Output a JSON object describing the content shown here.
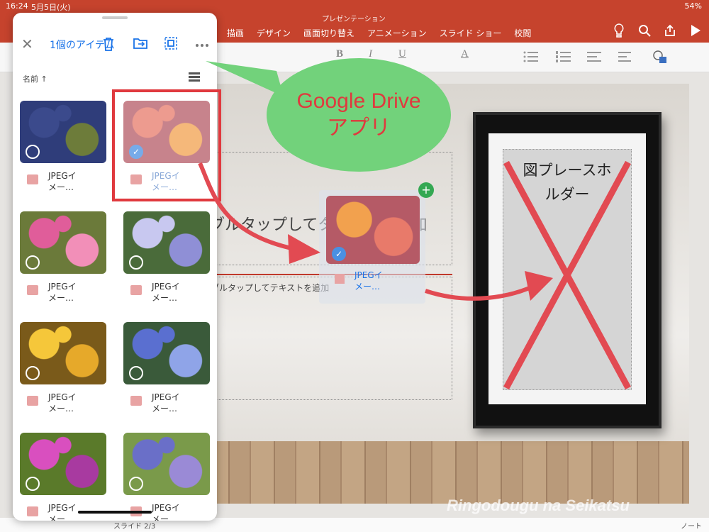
{
  "status": {
    "time": "16:24",
    "date": "5月5日(火)",
    "battery": "54%"
  },
  "ribbon": {
    "doc_title": "プレゼンテーション",
    "tabs": [
      "描画",
      "デザイン",
      "画面切り替え",
      "アニメーション",
      "スライド ショー",
      "校閲"
    ]
  },
  "toolbar": {
    "bold": "B",
    "italic": "I",
    "underline": "U",
    "color": "A"
  },
  "slide": {
    "title_placeholder": "ブルタップしてタイトルを追加",
    "text_placeholder": "ブルタップしてテキストを追加",
    "picture_placeholder_line1": "図プレースホ",
    "picture_placeholder_line2": "ルダー"
  },
  "drive_panel": {
    "header": "1個のアイテム",
    "sort_label": "名前 ↑",
    "items": [
      {
        "name": "JPEGイ\nメー…",
        "selected": false,
        "colors": [
          "#3b4a8c",
          "#6d7c3a",
          "#2f3d7a"
        ]
      },
      {
        "name": "JPEGイ\nメー…",
        "selected": true,
        "colors": [
          "#e87a6a",
          "#f2a14e",
          "#b55a66"
        ]
      },
      {
        "name": "JPEGイ\nメー…",
        "selected": false,
        "colors": [
          "#e05d9a",
          "#f28fb8",
          "#6b7a3a"
        ]
      },
      {
        "name": "JPEGイ\nメー…",
        "selected": false,
        "colors": [
          "#c8c8f0",
          "#8f8fd6",
          "#4a6b3a"
        ]
      },
      {
        "name": "JPEGイ\nメー…",
        "selected": false,
        "colors": [
          "#f5c73a",
          "#e6a92a",
          "#7a5a1a"
        ]
      },
      {
        "name": "JPEGイ\nメー…",
        "selected": false,
        "colors": [
          "#5a6fd0",
          "#8fa4e8",
          "#3a5a3a"
        ]
      },
      {
        "name": "JPEGイ\nメー…",
        "selected": false,
        "colors": [
          "#d94fbf",
          "#a83aa0",
          "#5a7a2a"
        ]
      },
      {
        "name": "JPEGイ\nメー…",
        "selected": false,
        "colors": [
          "#6a6fc8",
          "#9a8ad6",
          "#7a9a4a"
        ]
      }
    ]
  },
  "annotation": {
    "line1": "Google Drive",
    "line2": "アプリ"
  },
  "drag_ghost": {
    "name": "JPEGイ\nメー…"
  },
  "footer": {
    "slide": "スライド 2/3",
    "notes": "ノート"
  },
  "watermark": "Ringodougu na Seikatsu",
  "colors": {
    "ribbon": "#c6432d",
    "accent": "#1a73e8",
    "highlight": "#e0393e",
    "bubble": "#72d27b"
  }
}
